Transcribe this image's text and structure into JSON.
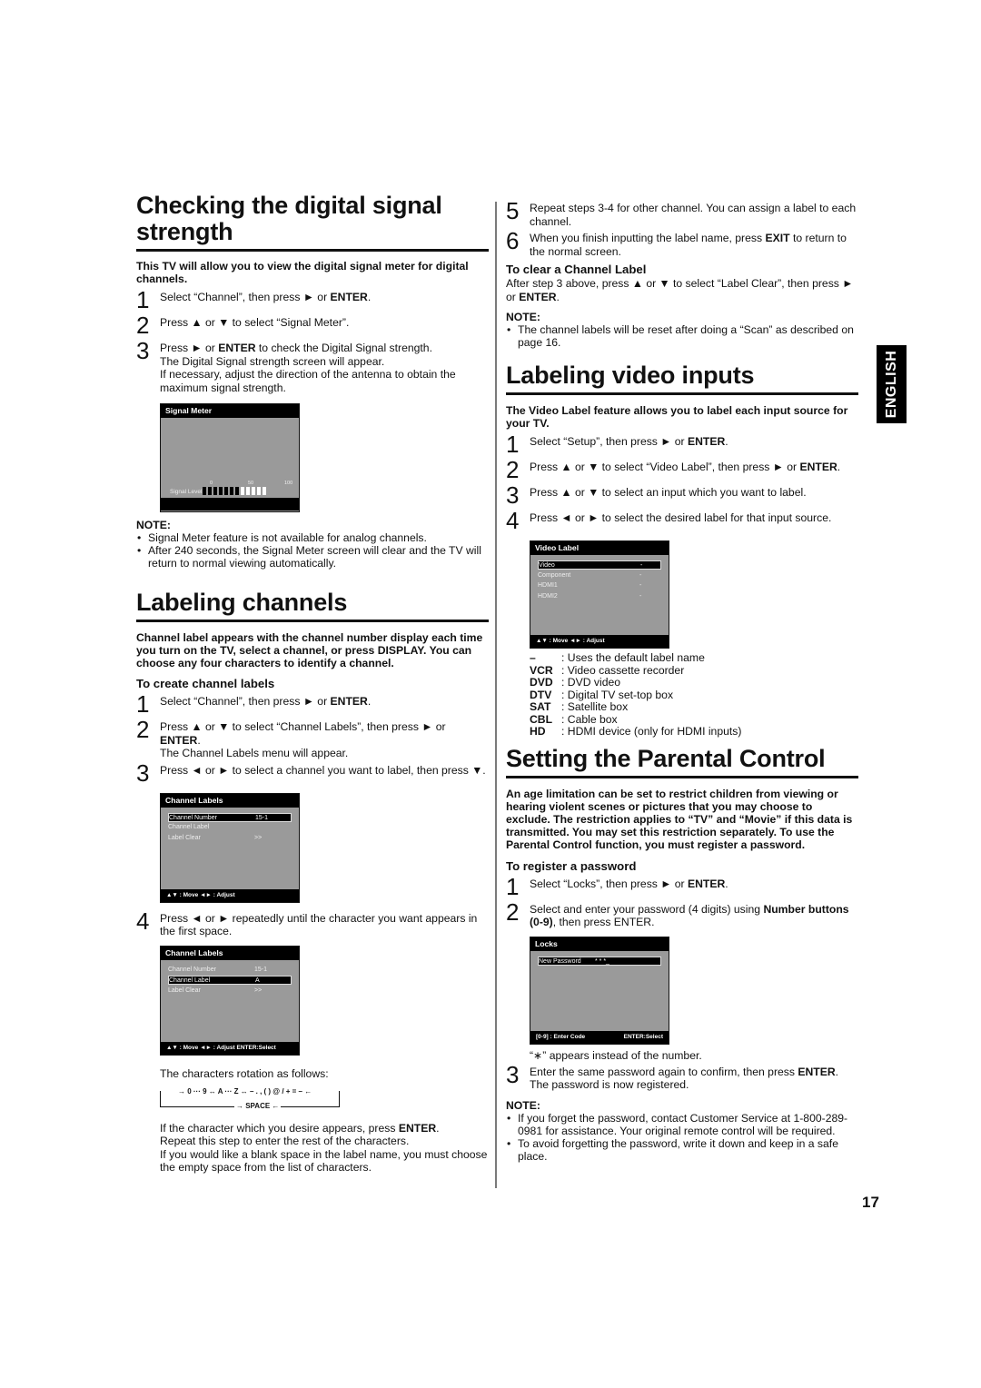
{
  "page_number": "17",
  "language_tab": "ENGLISH",
  "signal": {
    "title": "Checking the digital signal strength",
    "intro": "This TV will allow you to view the digital signal meter for digital channels.",
    "steps": [
      {
        "num": "1",
        "pre": "Select “Channel”, then press ► or ",
        "bold": "ENTER",
        "post": "."
      },
      {
        "num": "2",
        "pre": "Press ▲ or ▼ to select “Signal Meter”.",
        "bold": "",
        "post": ""
      },
      {
        "num": "3",
        "pre": "Press ► or ",
        "bold": "ENTER",
        "post": " to check the Digital Signal strength.",
        "extra": [
          "The Digital Signal strength screen will appear.",
          "If necessary, adjust the direction of the antenna to obtain the maximum signal strength."
        ]
      }
    ],
    "osd": {
      "header": "Signal Meter",
      "label": "Signal Level",
      "ticks": [
        "0",
        "50",
        "100"
      ],
      "bars_total": 12,
      "bars_filled": 7
    },
    "note_title": "NOTE:",
    "notes": [
      "Signal Meter feature is not available for analog channels.",
      "After 240 seconds, the Signal Meter screen will clear and the TV will return to normal viewing automatically."
    ]
  },
  "channels": {
    "title": "Labeling channels",
    "intro": "Channel label appears with the channel number display each time you turn on the TV, select a channel, or press DISPLAY. You can choose any four characters to identify a channel.",
    "subheading": "To create channel labels",
    "steps": [
      {
        "num": "1",
        "pre": "Select “Channel”, then press ► or ",
        "bold": "ENTER",
        "post": "."
      },
      {
        "num": "2",
        "pre": "Press ▲ or ▼ to select “Channel Labels”, then press ► or ",
        "bold": "ENTER",
        "post": ".",
        "extra": [
          "The Channel Labels menu will appear."
        ]
      },
      {
        "num": "3",
        "pre": "Press ◄ or ► to select a channel you want to label, then press ▼.",
        "bold": "",
        "post": ""
      },
      {
        "num": "4",
        "pre": "Press ◄ or ► repeatedly until the character you want appears in the first space.",
        "bold": "",
        "post": ""
      }
    ],
    "osd1": {
      "header": "Channel Labels",
      "rows": [
        {
          "label": "Channel Number",
          "value": "15-1"
        },
        {
          "label": "Channel Label",
          "value": ""
        },
        {
          "label": "Label Clear",
          "value": ">>"
        }
      ],
      "footer": "▲▼ : Move     ◄► : Adjust"
    },
    "osd2": {
      "header": "Channel Labels",
      "rows": [
        {
          "label": "Channel Number",
          "value": "15-1"
        },
        {
          "label": "Channel Label",
          "value": "A"
        },
        {
          "label": "Label Clear",
          "value": ">>"
        }
      ],
      "footer": "▲▼ : Move  ◄► : Adjust  ENTER:Select"
    },
    "rotation_intro": "The characters rotation as follows:",
    "rotation_line": "→ 0 ··· 9 ↔ A ··· Z ↔ – . , ( ) @ / + = – ←",
    "rotation_space": "→ SPACE ←",
    "after_pre": "If the character which you desire appears, press ",
    "after_bold": "ENTER",
    "after_post": ".",
    "after_lines": [
      "Repeat this step to enter the rest of the characters.",
      "If you would like a blank space in the label name, you must choose the empty space from the list of characters."
    ]
  },
  "channels_cont": {
    "steps": [
      {
        "num": "5",
        "pre": "Repeat steps 3-4 for other channel. You can assign a label to each channel.",
        "bold": "",
        "post": ""
      },
      {
        "num": "6",
        "pre": "When you finish inputting the label name, press ",
        "bold": "EXIT",
        "post": " to return to the normal screen."
      }
    ],
    "clear_heading": "To clear a Channel Label",
    "clear_pre": "After step 3 above, press ▲ or ▼ to select “Label Clear”, then press ► or ",
    "clear_bold": "ENTER",
    "clear_post": ".",
    "note_title": "NOTE:",
    "notes": [
      "The channel labels will be reset after doing a “Scan” as described on page 16."
    ]
  },
  "video": {
    "title": "Labeling video inputs",
    "intro": "The Video Label feature allows you to label each input source for your TV.",
    "steps": [
      {
        "num": "1",
        "pre": "Select “Setup”, then press ► or ",
        "bold": "ENTER",
        "post": "."
      },
      {
        "num": "2",
        "pre": "Press ▲ or ▼ to select “Video Label”, then press ► or ",
        "bold": "ENTER",
        "post": "."
      },
      {
        "num": "3",
        "pre": "Press ▲ or ▼ to select an input which you want to label.",
        "bold": "",
        "post": ""
      },
      {
        "num": "4",
        "pre": "Press ◄ or ► to select the desired label for that input source.",
        "bold": "",
        "post": ""
      }
    ],
    "osd": {
      "header": "Video Label",
      "rows": [
        {
          "label": "Video",
          "value": "-"
        },
        {
          "label": "Component",
          "value": "-"
        },
        {
          "label": "HDMI1",
          "value": "-"
        },
        {
          "label": "HDMI2",
          "value": "-"
        }
      ],
      "footer": "▲▼ : Move     ◄► : Adjust"
    },
    "labels": [
      {
        "key": "–",
        "desc": ": Uses the default label name"
      },
      {
        "key": "VCR",
        "desc": ": Video cassette recorder"
      },
      {
        "key": "DVD",
        "desc": ": DVD video"
      },
      {
        "key": "DTV",
        "desc": ": Digital TV set-top box"
      },
      {
        "key": "SAT",
        "desc": ": Satellite box"
      },
      {
        "key": "CBL",
        "desc": ": Cable box"
      },
      {
        "key": "HD",
        "desc": ": HDMI device (only for HDMI inputs)"
      }
    ]
  },
  "parental": {
    "title": "Setting the Parental Control",
    "intro": "An age limitation can be set to restrict children from viewing or hearing violent scenes or pictures that you may choose to exclude. The restriction applies to “TV” and “Movie” if this data is transmitted. You may set this restriction separately. To use the Parental Control function, you must register a password.",
    "subheading": "To register a password",
    "steps": [
      {
        "num": "1",
        "pre": "Select “Locks”, then press ► or ",
        "bold": "ENTER",
        "post": "."
      },
      {
        "num": "2",
        "pre": "Select and enter your password (4 digits) using ",
        "bold": "Number buttons (0-9)",
        "post": ", then press ENTER."
      }
    ],
    "osd": {
      "header": "Locks",
      "row_label": "New Password",
      "row_value": "* * *_",
      "footer_left": "[0-9] : Enter Code",
      "footer_right": "ENTER:Select"
    },
    "asterisk_note": "“∗” appears instead of the number.",
    "step3": {
      "num": "3",
      "pre": "Enter the same password again to confirm, then press ",
      "bold": "ENTER",
      "post": ".",
      "extra": [
        "The password is now registered."
      ]
    },
    "note_title": "NOTE:",
    "notes": [
      "If you forget the password, contact Customer Service at 1-800-289-0981 for assistance. Your original remote control will be required.",
      "To avoid forgetting the password, write it down and keep in a safe place."
    ]
  }
}
